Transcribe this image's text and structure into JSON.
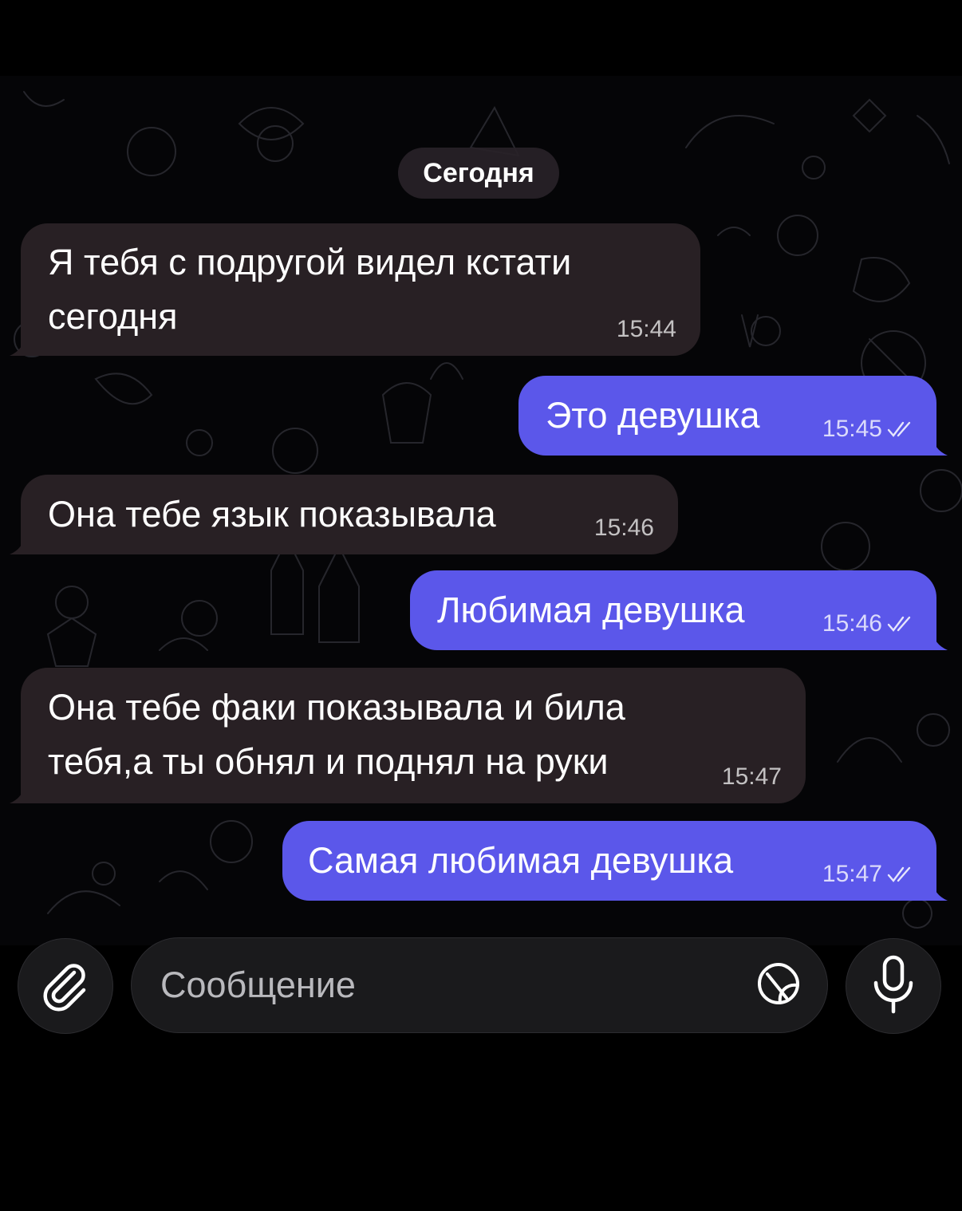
{
  "chat": {
    "date_label": "Сегодня",
    "messages": [
      {
        "direction": "in",
        "text_line1": "Я тебя с подругой видел кстати",
        "text_line2": "сегодня",
        "time": "15:44"
      },
      {
        "direction": "out",
        "text": "Это девушка",
        "time": "15:45",
        "status": "read"
      },
      {
        "direction": "in",
        "text": "Она тебе язык показывала",
        "time": "15:46"
      },
      {
        "direction": "out",
        "text": "Любимая девушка",
        "time": "15:46",
        "status": "read"
      },
      {
        "direction": "in",
        "text_line1": "Она тебе факи показывала и била",
        "text_line2": "тебя,а ты обнял и поднял на руки",
        "time": "15:47"
      },
      {
        "direction": "out",
        "text": "Самая любимая девушка",
        "time": "15:47",
        "status": "read"
      }
    ]
  },
  "composer": {
    "placeholder": "Сообщение",
    "attach_icon": "paperclip-icon",
    "sticker_icon": "sticker-icon",
    "mic_icon": "microphone-icon"
  },
  "colors": {
    "outgoing_bubble": "#5b57ea",
    "incoming_bubble": "#282024",
    "background": "#000000"
  }
}
